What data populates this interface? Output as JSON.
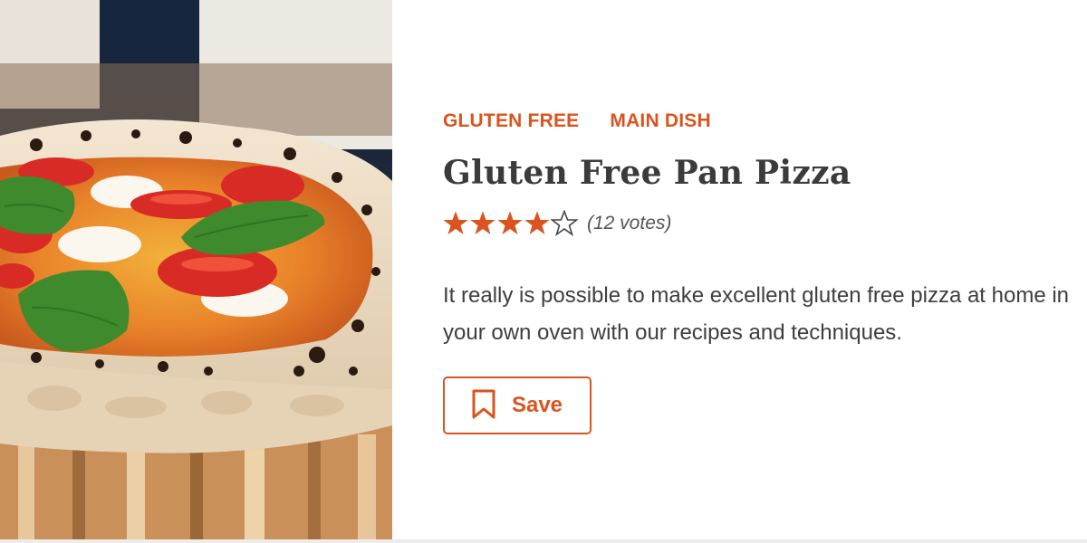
{
  "recipe": {
    "tags": [
      "GLUTEN FREE",
      "MAIN DISH"
    ],
    "title": "Gluten Free Pan Pizza",
    "rating": {
      "value": 4,
      "max": 5,
      "votes_label": "(12 votes)"
    },
    "description": "It really is possible to make excellent gluten free pizza at home in your own oven with our recipes and techniques.",
    "save_label": "Save",
    "image_icon": "pizza-photo"
  },
  "colors": {
    "accent": "#d9541e",
    "title": "#3b3b3b",
    "body": "#3e3e3e"
  }
}
